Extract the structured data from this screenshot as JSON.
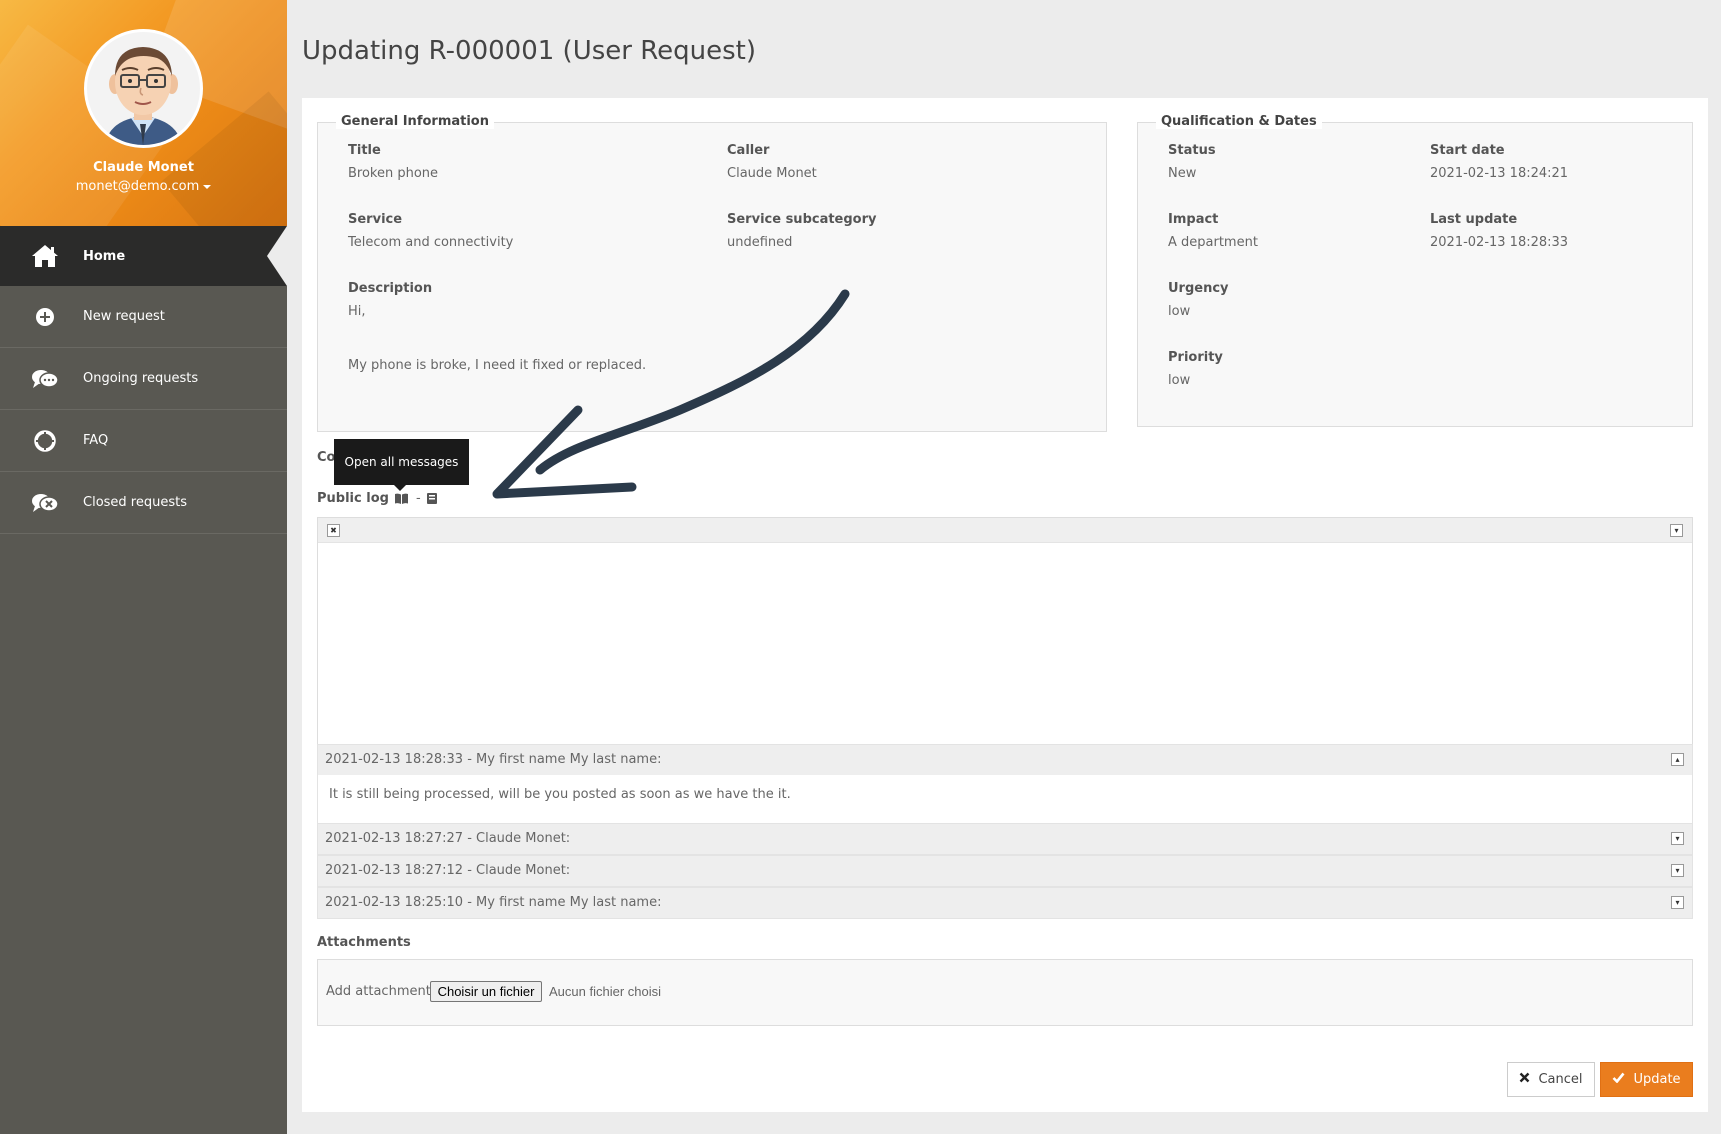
{
  "user": {
    "name": "Claude Monet",
    "email": "monet@demo.com"
  },
  "menu": {
    "items": [
      {
        "label": "Home",
        "icon": "home-icon",
        "active": true
      },
      {
        "label": "New request",
        "icon": "plus-circle-icon"
      },
      {
        "label": "Ongoing requests",
        "icon": "chat-bubbles-icon"
      },
      {
        "label": "FAQ",
        "icon": "lifebuoy-icon"
      },
      {
        "label": "Closed requests",
        "icon": "chat-closed-icon"
      }
    ]
  },
  "page": {
    "title": "Updating R-000001 (User Request)"
  },
  "general": {
    "legend": "General Information",
    "title_label": "Title",
    "title_value": "Broken phone",
    "caller_label": "Caller",
    "caller_value": "Claude Monet",
    "service_label": "Service",
    "service_value": "Telecom and connectivity",
    "subcat_label": "Service subcategory",
    "subcat_value": "undefined",
    "description_label": "Description",
    "description_line1": "Hi,",
    "description_line2": "My phone is broke, I need it fixed or replaced."
  },
  "qualification": {
    "legend": "Qualification & Dates",
    "status_label": "Status",
    "status_value": "New",
    "start_label": "Start date",
    "start_value": "2021-02-13 18:24:21",
    "impact_label": "Impact",
    "impact_value": "A department",
    "update_label": "Last update",
    "update_value": "2021-02-13 18:28:33",
    "urgency_label": "Urgency",
    "urgency_value": "low",
    "priority_label": "Priority",
    "priority_value": "low"
  },
  "contacts": {
    "label_partial": "Co"
  },
  "tooltip": {
    "text": "Open all messages"
  },
  "public_log": {
    "label": "Public log",
    "separator": "-",
    "entries": [
      {
        "header": "2021-02-13 18:28:33 - My first name My last name:",
        "body": "It is still being processed, will be you posted as soon as we have the it.",
        "expanded": true
      },
      {
        "header": "2021-02-13 18:27:27 - Claude Monet:",
        "expanded": false
      },
      {
        "header": "2021-02-13 18:27:12 - Claude Monet:",
        "expanded": false
      },
      {
        "header": "2021-02-13 18:25:10 - My first name My last name:",
        "expanded": false
      }
    ]
  },
  "attachments": {
    "label": "Attachments",
    "add_label": "Add attachment:",
    "file_button": "Choisir un fichier",
    "no_file": "Aucun fichier choisi"
  },
  "actions": {
    "cancel": "Cancel",
    "update": "Update"
  },
  "colors": {
    "accent": "#ea7d1e",
    "sidebar": "#595852",
    "active_menu": "#2b2b2a"
  }
}
